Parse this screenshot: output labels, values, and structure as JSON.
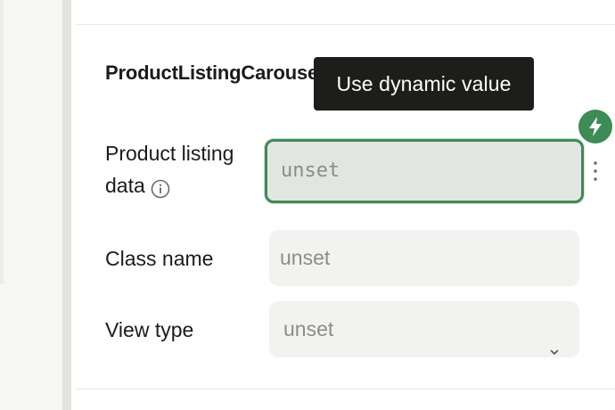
{
  "section": {
    "title": "ProductListingCarousel"
  },
  "tooltip": {
    "text": "Use dynamic value"
  },
  "fields": {
    "product_listing": {
      "label_line1": "Product listing",
      "label_line2": "data",
      "value": "unset",
      "state": "focused-dynamic"
    },
    "class_name": {
      "label": "Class name",
      "value": "unset"
    },
    "view_type": {
      "label": "View type",
      "value": "unset"
    }
  },
  "icons": {
    "info": "info-icon",
    "bolt": "bolt-icon",
    "more": "more-vertical-icon",
    "chevron": "chevron-down-icon"
  },
  "colors": {
    "accent": "#3d8b56",
    "tooltip_bg": "#1d1d1b",
    "field_bg": "#f2f2f0"
  }
}
